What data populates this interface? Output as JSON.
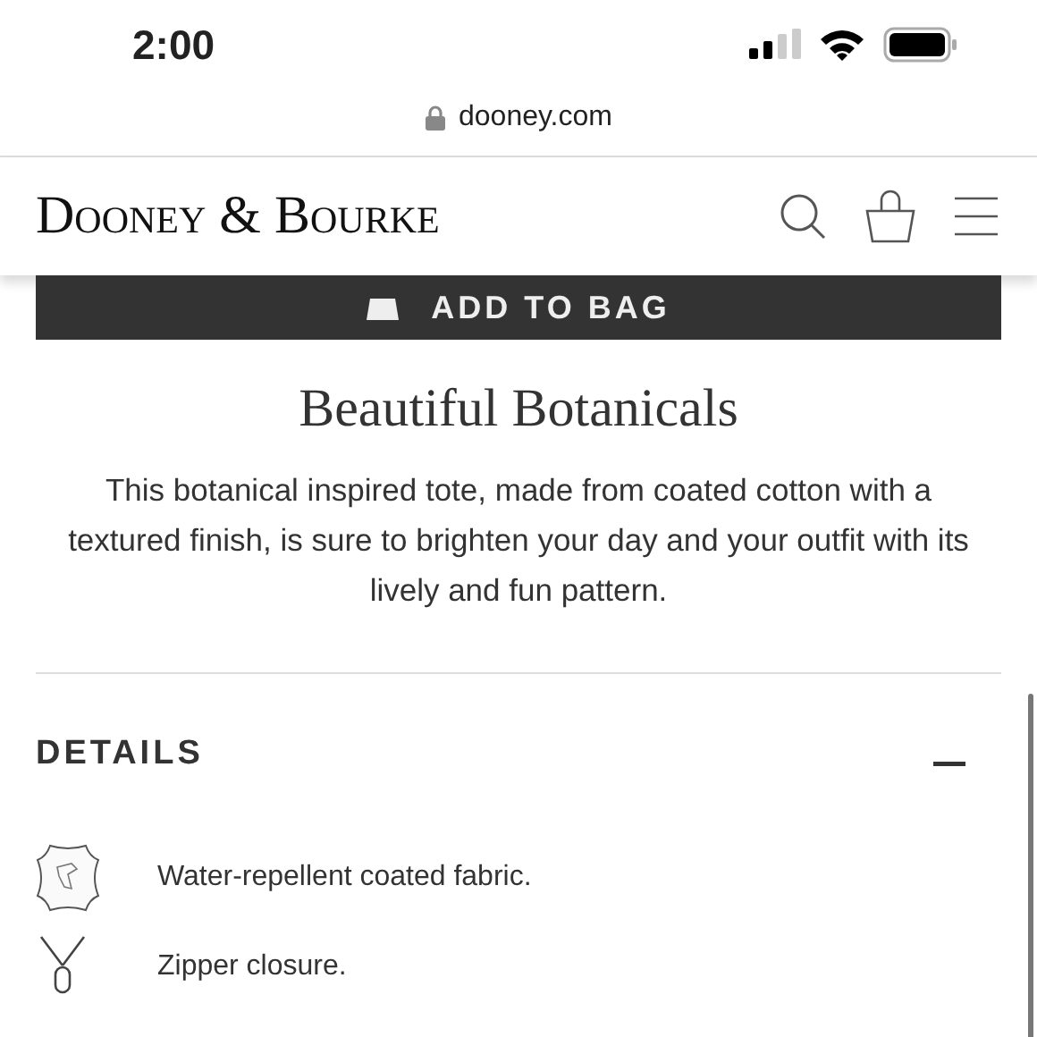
{
  "status_bar": {
    "time": "2:00"
  },
  "address_bar": {
    "url": "dooney.com"
  },
  "header": {
    "logo": "Dooney & Bourke"
  },
  "add_to_bag": {
    "label": "ADD TO BAG"
  },
  "product": {
    "title": "Beautiful Botanicals",
    "description": "This botanical inspired tote, made from coated cotton with a textured finish, is sure to brighten your day and your outfit with its lively and fun pattern."
  },
  "details": {
    "heading": "DETAILS",
    "expanded": true,
    "items": [
      {
        "kind": "leather",
        "text": "Water-repellent coated fabric."
      },
      {
        "kind": "zipper",
        "text": "Zipper closure."
      }
    ]
  }
}
